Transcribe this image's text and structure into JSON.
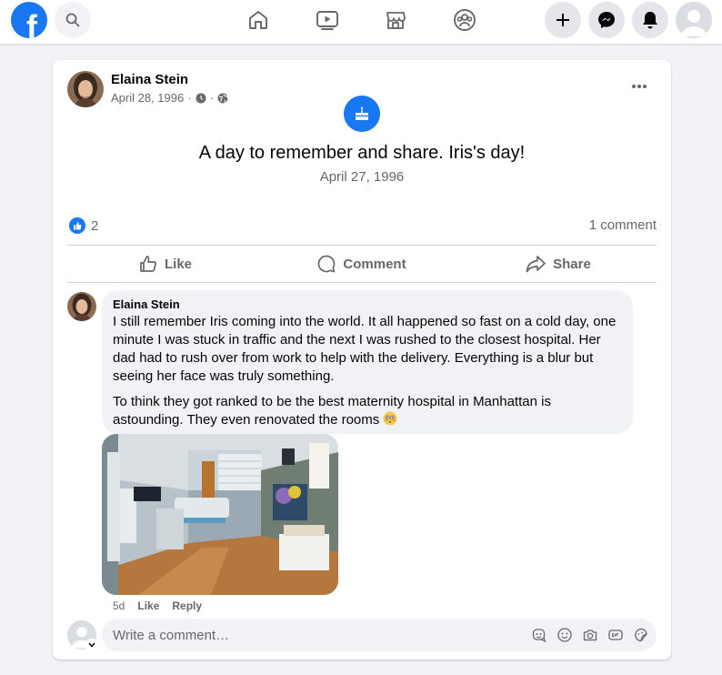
{
  "nav": {
    "logo_letter": "f",
    "icons": [
      "search-icon",
      "home-icon",
      "watch-icon",
      "marketplace-icon",
      "groups-icon",
      "create-icon",
      "messenger-icon",
      "notifications-icon",
      "account-icon"
    ]
  },
  "post": {
    "author": "Elaina Stein",
    "date": "April 28, 1996",
    "separator": "·",
    "event_title": "A day to remember and share. Iris's day!",
    "event_date": "April 27, 1996",
    "like_count": "2",
    "comment_count": "1 comment",
    "actions": {
      "like": "Like",
      "comment": "Comment",
      "share": "Share"
    }
  },
  "comment": {
    "author": "Elaina Stein",
    "paragraph1": "I still remember Iris coming into the world. It all happened so fast on a cold day, one minute I was stuck in traffic and the next I was rushed to the closest hospital. Her dad had to rush over from work to help with the delivery. Everything is a blur but seeing her face was truly something.",
    "paragraph2": "To think they got ranked to be the best maternity hospital in Manhattan is astounding. They even renovated the rooms",
    "age": "5d",
    "like": "Like",
    "reply": "Reply"
  },
  "write_comment": {
    "placeholder": "Write a comment…"
  },
  "colors": {
    "brand": "#1877f2",
    "background": "#f0f2f5",
    "secondary_text": "#65676b"
  }
}
